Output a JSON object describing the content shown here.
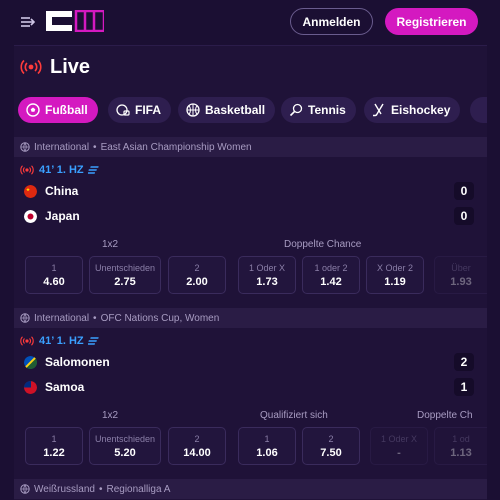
{
  "header": {
    "login_label": "Anmelden",
    "register_label": "Registrieren"
  },
  "live": {
    "title": "Live"
  },
  "tabs": [
    {
      "label": "Fußball",
      "icon": "soccer-ball-icon",
      "active": true
    },
    {
      "label": "FIFA",
      "icon": "gamepad-icon"
    },
    {
      "label": "Basketball",
      "icon": "basketball-icon"
    },
    {
      "label": "Tennis",
      "icon": "tennis-racket-icon"
    },
    {
      "label": "Eishockey",
      "icon": "hockey-stick-icon"
    }
  ],
  "matches": [
    {
      "league": {
        "region": "International",
        "name": "East Asian Championship Women"
      },
      "time": "41’ 1. HZ",
      "team1": {
        "name": "China",
        "score": "0"
      },
      "team2": {
        "name": "Japan",
        "score": "0"
      },
      "market1": {
        "title": "1x2",
        "odds": [
          {
            "label": "1",
            "value": "4.60"
          },
          {
            "label": "Unentschieden",
            "value": "2.75"
          },
          {
            "label": "2",
            "value": "2.00"
          }
        ]
      },
      "market2": {
        "title": "Doppelte Chance",
        "odds": [
          {
            "label": "1 Oder X",
            "value": "1.73"
          },
          {
            "label": "1 oder 2",
            "value": "1.42"
          },
          {
            "label": "X Oder 2",
            "value": "1.19"
          }
        ]
      },
      "market3": {
        "odds": [
          {
            "label": "Über",
            "value": "1.93"
          }
        ]
      }
    },
    {
      "league": {
        "region": "International",
        "name": "OFC Nations Cup, Women"
      },
      "time": "41’ 1. HZ",
      "team1": {
        "name": "Salomonen",
        "score": "2"
      },
      "team2": {
        "name": "Samoa",
        "score": "1"
      },
      "market1": {
        "title": "1x2",
        "odds": [
          {
            "label": "1",
            "value": "1.22"
          },
          {
            "label": "Unentschieden",
            "value": "5.20"
          },
          {
            "label": "2",
            "value": "14.00"
          }
        ]
      },
      "market2": {
        "title": "Qualifiziert sich",
        "odds": [
          {
            "label": "1",
            "value": "1.06"
          },
          {
            "label": "2",
            "value": "7.50"
          }
        ]
      },
      "market3": {
        "title": "Doppelte Ch",
        "odds": [
          {
            "label": "1 Oder X",
            "value": "-"
          },
          {
            "label": "1 od",
            "value": "1.13"
          }
        ]
      }
    }
  ],
  "next_league": {
    "region": "Weißrussland",
    "name": "Regionalliga A"
  },
  "colors": {
    "accent": "#d419c0",
    "live_red": "#ff3b3b",
    "time_blue": "#3aa0ff",
    "background": "#1f1238"
  }
}
